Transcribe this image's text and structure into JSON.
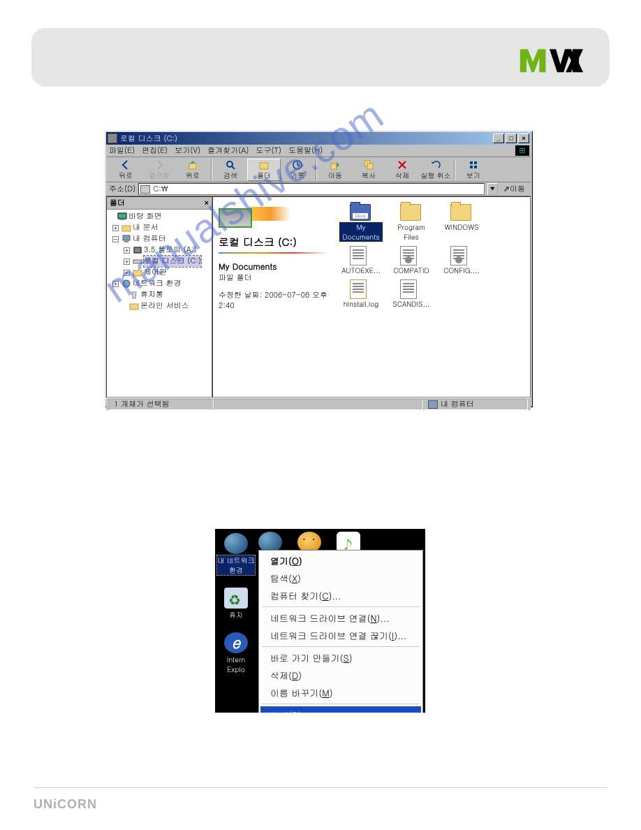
{
  "brand": {
    "logo_text_m": "M",
    "logo_text_v": "V",
    "logo_text_ix": "ix"
  },
  "explorer": {
    "title": "로컬 디스크 (C:)",
    "menu": {
      "file": "파일(E)",
      "edit": "편집(E)",
      "view": "보기(V)",
      "favorites": "즐겨찾기(A)",
      "tools": "도구(T)",
      "help": "도움말(H)"
    },
    "toolbar": {
      "back": "뒤로",
      "forward": "앞으로",
      "up": "위로",
      "search": "검색",
      "folders": "폴더",
      "history": "기록",
      "move": "이동",
      "copy": "복사",
      "delete": "삭제",
      "undo": "실행 취소",
      "views": "보기"
    },
    "address": {
      "label": "주소(D)",
      "value": "C:\\",
      "go": "이동"
    },
    "folders_panel": {
      "title": "폴더",
      "close": "×",
      "desktop": "바탕 화면",
      "my_docs": "내 문서",
      "my_computer": "내 컴퓨터",
      "floppy": "3.5 플로피 (A:)",
      "local_c": "로컬 디스크 (C:)",
      "control": "제어판",
      "network": "네트워크 환경",
      "recycle": "휴지통",
      "online": "온라인 서비스"
    },
    "info": {
      "drive_title": "로컬 디스크 (C:)",
      "sel_name": "My Documents",
      "sel_type": "파일 폴더",
      "sel_meta": "수정한 날짜: 2006-07-06 오후 2:40"
    },
    "icons": [
      {
        "name": "My Documents",
        "type": "folder",
        "sel": true,
        "style": "blue"
      },
      {
        "name": "Program Files",
        "type": "folder"
      },
      {
        "name": "WINDOWS",
        "type": "folder"
      },
      {
        "name": "AUTOEXE...",
        "type": "doc"
      },
      {
        "name": "COMPATID",
        "type": "doc",
        "gear": true
      },
      {
        "name": "CONFIG....",
        "type": "doc",
        "gear": true
      },
      {
        "name": "hInstall.log",
        "type": "doc",
        "log": true
      },
      {
        "name": "SCANDIS...",
        "type": "doc"
      }
    ],
    "status": {
      "left": "1 개체가 선택됨",
      "right": "내 컴퓨터"
    }
  },
  "context": {
    "desktop_icons": {
      "network_env_1": "내 네트워크",
      "network_env_2": "환경",
      "recycle_short": "휴지",
      "ie_1": "Intern",
      "ie_2": "Explo"
    },
    "menu": [
      {
        "text": "열기(O)",
        "bold": true
      },
      {
        "text": "탐색(X)"
      },
      {
        "text": "컴퓨터 찾기(C)..."
      },
      {
        "sep": true
      },
      {
        "text": "네트워크 드라이브 연결(N)..."
      },
      {
        "text": "네트워크 드라이브 연결 끊기(I)..."
      },
      {
        "sep": true
      },
      {
        "text": "바로 가기 만들기(S)"
      },
      {
        "text": "삭제(D)"
      },
      {
        "text": "이름 바꾸기(M)"
      },
      {
        "sep": true
      },
      {
        "text": "속성(R)",
        "highlight": true
      }
    ]
  },
  "watermark": "manualshive.com",
  "footer": "UNiCORN"
}
